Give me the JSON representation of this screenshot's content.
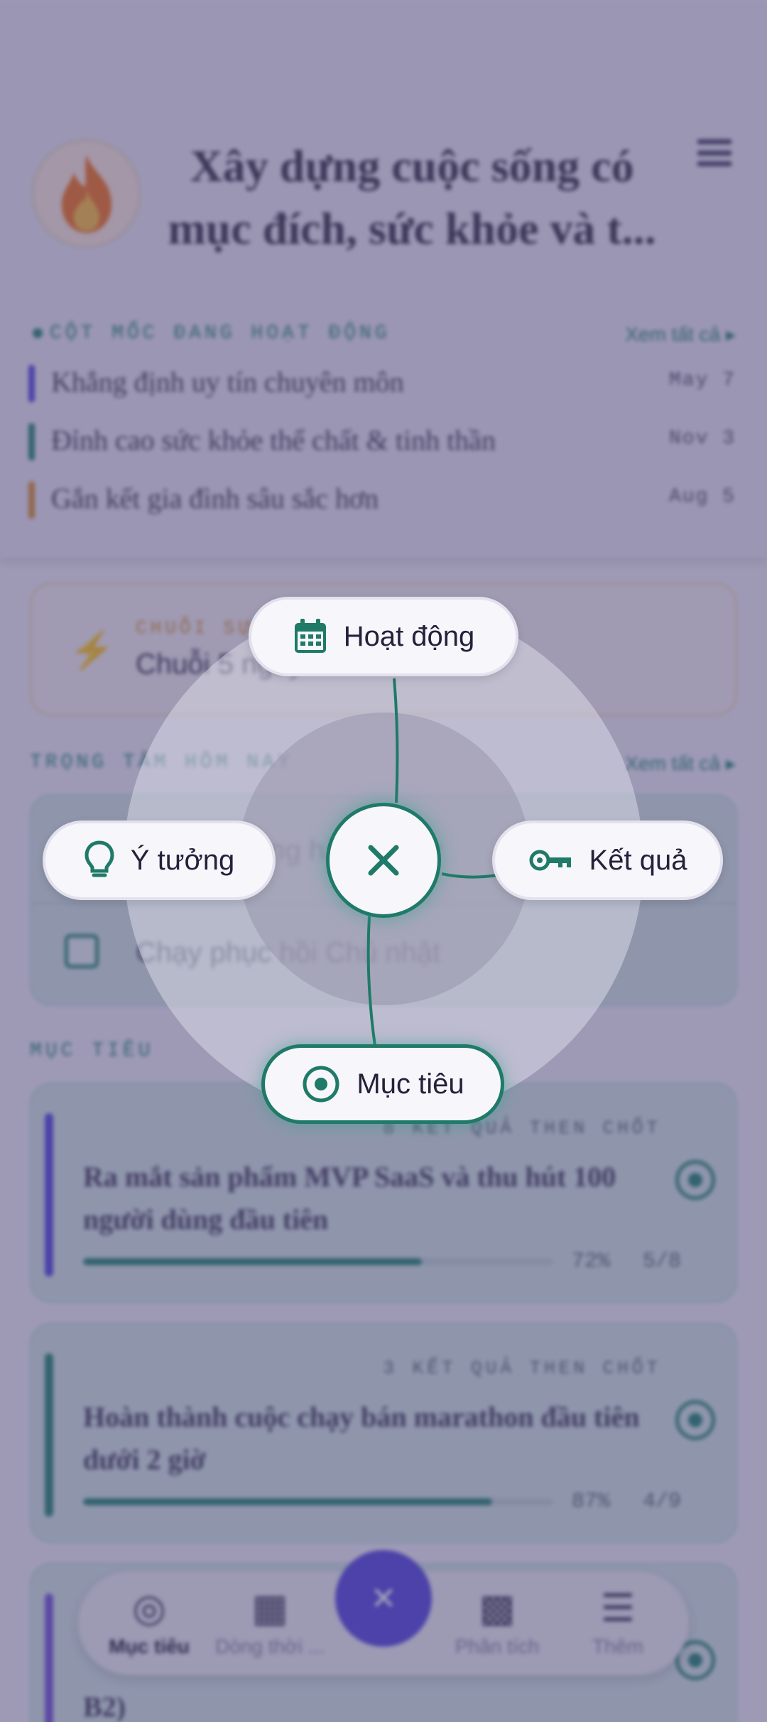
{
  "colors": {
    "accent_teal": "#1f7a68",
    "accent_purple": "#5b4fe0",
    "milestone_bars": [
      "#5b4fe0",
      "#2f8a77",
      "#d9933a"
    ]
  },
  "header": {
    "avatar_icon": "flame-icon",
    "title": "Xây dựng cuộc sống có mục đích, sức khỏe và t...",
    "menu_icon": "hamburger-menu-icon"
  },
  "milestones": {
    "section_title": "CỘT MỐC ĐANG HOẠT ĐỘNG",
    "see_all": "Xem tất cả  ▸",
    "items": [
      {
        "label": "Khẳng định uy tín chuyên môn",
        "date": "May 7"
      },
      {
        "label": "Đỉnh cao sức khỏe thể chất & tinh thần",
        "date": "Nov 3"
      },
      {
        "label": "Gắn kết gia đình sâu sắc hơn",
        "date": "Aug 5"
      }
    ]
  },
  "streak": {
    "label": "CHUỖI SỰ KIỆN",
    "text": "Chuỗi 5 ngày"
  },
  "focus": {
    "section_title": "TRỌNG TÂM HÔM NAY",
    "see_all": "Xem tất cả  ▸",
    "items": [
      {
        "text": "Viết nội dung hàng ngày"
      },
      {
        "text": "Chạy phục hồi Chủ nhật"
      }
    ]
  },
  "goals": {
    "section_title": "MỤC TIÊU",
    "items": [
      {
        "kr": "8 KẾT QUẢ THEN CHỐT",
        "title": "Ra mắt sản phẩm MVP SaaS và thu hút 100 người dùng đầu tiên",
        "progress_pct": 72,
        "progress_label": "72%",
        "tasks": "5/8"
      },
      {
        "kr": "3 KẾT QUẢ THEN CHỐT",
        "title": "Hoàn thành cuộc chạy bán marathon đầu tiên dưới 2 giờ",
        "progress_pct": 87,
        "progress_label": "87%",
        "tasks": "4/9"
      },
      {
        "kr": "",
        "title": "B2)",
        "progress_pct": 0,
        "progress_label": "",
        "tasks": ""
      }
    ]
  },
  "bottom_nav": {
    "items": [
      {
        "label": "Mục tiêu",
        "icon": "target-icon",
        "active": true
      },
      {
        "label": "Dòng thời ...",
        "icon": "calendar-icon",
        "active": false
      },
      {
        "label": "Phân tích",
        "icon": "analytics-icon",
        "active": false
      },
      {
        "label": "Thêm",
        "icon": "menu-icon",
        "active": false
      }
    ]
  },
  "radial_menu": {
    "activity": {
      "label": "Hoạt động",
      "icon": "calendar-icon"
    },
    "idea": {
      "label": "Ý tưởng",
      "icon": "lightbulb-icon"
    },
    "result": {
      "label": "Kết quả",
      "icon": "key-icon"
    },
    "goal": {
      "label": "Mục tiêu",
      "icon": "target-icon"
    },
    "close_icon": "close-icon"
  }
}
